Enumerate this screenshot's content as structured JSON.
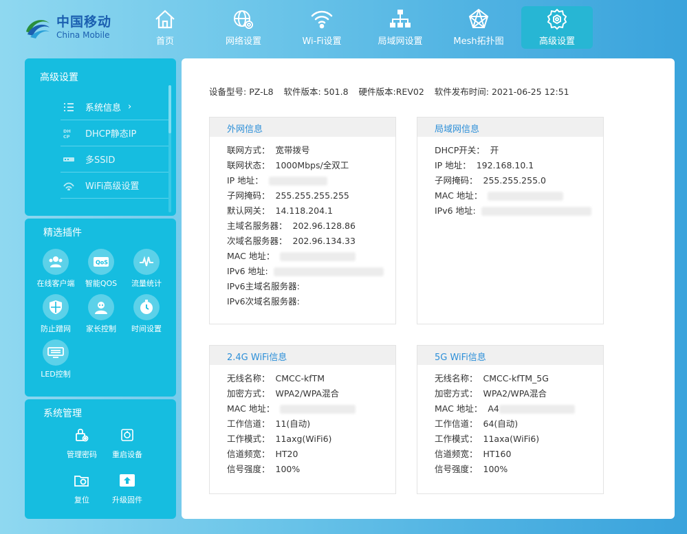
{
  "brand": {
    "name_cn": "中国移动",
    "name_en": "China Mobile",
    "color": "#1b5fb0"
  },
  "nav": [
    {
      "label": "首页",
      "icon": "home-icon"
    },
    {
      "label": "网络设置",
      "icon": "globe-gear-icon"
    },
    {
      "label": "Wi-Fi设置",
      "icon": "wifi-icon"
    },
    {
      "label": "局域网设置",
      "icon": "lan-icon"
    },
    {
      "label": "Mesh拓扑图",
      "icon": "mesh-icon"
    },
    {
      "label": "高级设置",
      "icon": "advanced-gear-icon",
      "active": true
    }
  ],
  "sidebar": {
    "advanced": {
      "title": "高级设置",
      "items": [
        {
          "label": "系统信息",
          "icon": "list-icon",
          "active": true
        },
        {
          "label": "DHCP静态IP",
          "icon": "dhcp-icon"
        },
        {
          "label": "多SSID",
          "icon": "ssid-icon"
        },
        {
          "label": "WiFi高级设置",
          "icon": "wifi-advanced-icon"
        }
      ]
    },
    "plugins": {
      "title": "精选插件",
      "items": [
        {
          "label": "在线客户端",
          "icon": "clients-icon"
        },
        {
          "label": "智能QOS",
          "icon": "qos-icon"
        },
        {
          "label": "流量统计",
          "icon": "traffic-icon"
        },
        {
          "label": "防止蹭网",
          "icon": "shield-icon"
        },
        {
          "label": "家长控制",
          "icon": "parental-icon"
        },
        {
          "label": "时间设置",
          "icon": "clock-icon"
        },
        {
          "label": "LED控制",
          "icon": "led-icon"
        }
      ]
    },
    "system": {
      "title": "系统管理",
      "items": [
        {
          "label": "管理密码",
          "icon": "lock-icon"
        },
        {
          "label": "重启设备",
          "icon": "restart-icon"
        },
        {
          "label": "复位",
          "icon": "reset-icon"
        },
        {
          "label": "升级固件",
          "icon": "upgrade-icon"
        }
      ]
    }
  },
  "device": {
    "model_label": "设备型号:",
    "model": "PZ-L8",
    "sw_label": "软件版本:",
    "sw": "501.8",
    "hw_label": "硬件版本:",
    "hw": "REV02",
    "release_label": "软件发布时间:",
    "release": "2021-06-25 12:51"
  },
  "wan": {
    "title": "外网信息",
    "rows": [
      {
        "k": "联网方式：",
        "v": "宽带拨号"
      },
      {
        "k": "联网状态：",
        "v": "1000Mbps/全双工"
      },
      {
        "k": "IP 地址：",
        "v": "",
        "blurred": true
      },
      {
        "k": "子网掩码：",
        "v": "255.255.255.255"
      },
      {
        "k": "默认网关：",
        "v": "14.118.204.1"
      },
      {
        "k": "主域名服务器：",
        "v": "202.96.128.86"
      },
      {
        "k": "次域名服务器：",
        "v": "202.96.134.33"
      },
      {
        "k": "MAC 地址：",
        "v": "",
        "blurred": true
      },
      {
        "k": "IPv6 地址:",
        "v": "",
        "blurred": true
      },
      {
        "k": "IPv6主域名服务器:",
        "v": ""
      },
      {
        "k": "IPv6次域名服务器:",
        "v": ""
      }
    ]
  },
  "lan": {
    "title": "局域网信息",
    "rows": [
      {
        "k": "DHCP开关：",
        "v": "开"
      },
      {
        "k": "IP 地址：",
        "v": "192.168.10.1"
      },
      {
        "k": "子网掩码：",
        "v": "255.255.255.0"
      },
      {
        "k": "MAC 地址：",
        "v": "",
        "blurred": true
      },
      {
        "k": "IPv6 地址:",
        "v": "",
        "blurred": true
      }
    ]
  },
  "wifi24": {
    "title": "2.4G WiFi信息",
    "rows": [
      {
        "k": "无线名称：",
        "v": "CMCC-kfTM"
      },
      {
        "k": "加密方式：",
        "v": "WPA2/WPA混合"
      },
      {
        "k": "MAC 地址：",
        "v": "",
        "blurred": true
      },
      {
        "k": "工作信道：",
        "v": "11(自动)"
      },
      {
        "k": "工作模式：",
        "v": "11axg(WiFi6)"
      },
      {
        "k": "信道频宽：",
        "v": "HT20"
      },
      {
        "k": "信号强度：",
        "v": "100%"
      }
    ]
  },
  "wifi5": {
    "title": "5G WiFi信息",
    "rows": [
      {
        "k": "无线名称：",
        "v": "CMCC-kfTM_5G"
      },
      {
        "k": "加密方式：",
        "v": "WPA2/WPA混合"
      },
      {
        "k": "MAC 地址：",
        "v": "A4",
        "blurred": true
      },
      {
        "k": "工作信道：",
        "v": "64(自动)"
      },
      {
        "k": "工作模式：",
        "v": "11axa(WiFi6)"
      },
      {
        "k": "信道频宽：",
        "v": "HT160"
      },
      {
        "k": "信号强度：",
        "v": "100%"
      }
    ]
  }
}
